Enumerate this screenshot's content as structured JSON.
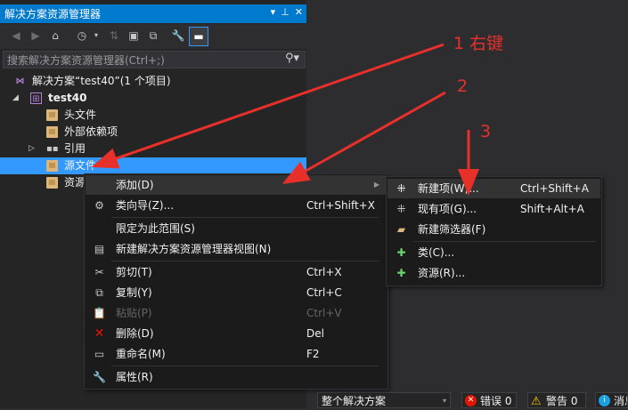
{
  "panel": {
    "title": "解决方案资源管理器",
    "search_placeholder": "搜索解决方案资源管理器(Ctrl+;)"
  },
  "tree": {
    "solution": "解决方案“test40”(1 个项目)",
    "project": "test40",
    "items": [
      {
        "label": "头文件"
      },
      {
        "label": "外部依赖项"
      },
      {
        "label": "引用"
      },
      {
        "label": "源文件"
      },
      {
        "label": "资源"
      }
    ]
  },
  "context_menu": [
    {
      "label": "添加(D)",
      "shortcut": ""
    },
    {
      "label": "类向导(Z)...",
      "shortcut": "Ctrl+Shift+X"
    },
    {
      "label": "限定为此范围(S)",
      "shortcut": ""
    },
    {
      "label": "新建解决方案资源管理器视图(N)",
      "shortcut": ""
    },
    {
      "label": "剪切(T)",
      "shortcut": "Ctrl+X"
    },
    {
      "label": "复制(Y)",
      "shortcut": "Ctrl+C"
    },
    {
      "label": "粘贴(P)",
      "shortcut": "Ctrl+V"
    },
    {
      "label": "删除(D)",
      "shortcut": "Del"
    },
    {
      "label": "重命名(M)",
      "shortcut": "F2"
    },
    {
      "label": "属性(R)",
      "shortcut": ""
    }
  ],
  "submenu": [
    {
      "label": "新建项(W)...",
      "shortcut": "Ctrl+Shift+A"
    },
    {
      "label": "现有项(G)...",
      "shortcut": "Shift+Alt+A"
    },
    {
      "label": "新建筛选器(F)",
      "shortcut": ""
    },
    {
      "label": "类(C)...",
      "shortcut": ""
    },
    {
      "label": "资源(R)...",
      "shortcut": ""
    }
  ],
  "annotations": {
    "note1": "1 右键",
    "note2": "2",
    "note3": "3"
  },
  "bottom": {
    "scope_label": "整个解决方案",
    "errors": "错误 0",
    "warnings": "警告 0",
    "messages": "消息"
  },
  "colors": {
    "accent": "#007acc",
    "selection": "#3399ff",
    "annotation": "#e8302a"
  }
}
